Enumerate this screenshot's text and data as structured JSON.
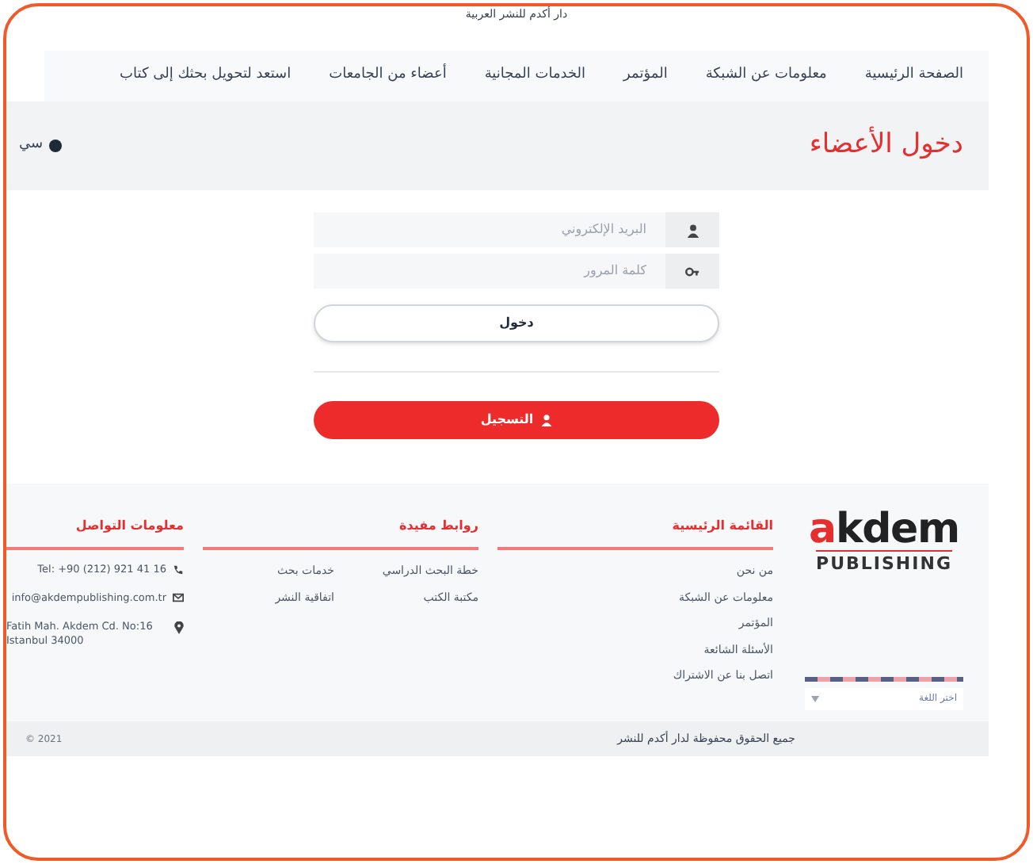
{
  "site_tagline": "دار أكدم للنشر العربية",
  "nav": [
    {
      "label": "الصفحة الرئيسية"
    },
    {
      "label": "معلومات عن الشبكة"
    },
    {
      "label": "المؤتمر"
    },
    {
      "label": "الخدمات المجانية"
    },
    {
      "label": "أعضاء من الجامعات"
    },
    {
      "label": "استعد لتحويل بحثك إلى كتاب"
    }
  ],
  "page_title": "دخول الأعضاء",
  "breadcrumb": "سي",
  "login": {
    "email_placeholder": "البريد الإلكتروني",
    "password_placeholder": "كلمة المرور",
    "submit": "دخول",
    "register": "التسجيل"
  },
  "footer": {
    "logo": {
      "brand_first": "a",
      "brand_rest": "kdem",
      "sub": "PUBLISHING"
    },
    "columns": [
      {
        "title": "القائمة الرئيسية",
        "links": [
          "من نحن",
          "معلومات عن الشبكة",
          "المؤتمر",
          "الأسئلة الشائعة",
          "اتصل بنا عن الاشتراك"
        ]
      },
      {
        "title": "روابط مفيدة",
        "links": [
          "خطة البحث الدراسي",
          "خدمات بحث",
          "مكتبة الكتب",
          "اتفاقية النشر"
        ]
      },
      {
        "title": "معلومات التواصل",
        "contacts": [
          {
            "kind": "phone",
            "text": "Tel: +90 (212) 921 41 16"
          },
          {
            "kind": "email",
            "text": "info@akdempublishing.com.tr"
          },
          {
            "kind": "address",
            "text": "Fatih Mah. Akdem Cd. No:16 Istanbul 34000"
          }
        ]
      }
    ],
    "language": "اختر اللغة",
    "copyright": "جميع الحقوق محفوظة لدار أكدم للنشر",
    "year": "© 2021"
  }
}
